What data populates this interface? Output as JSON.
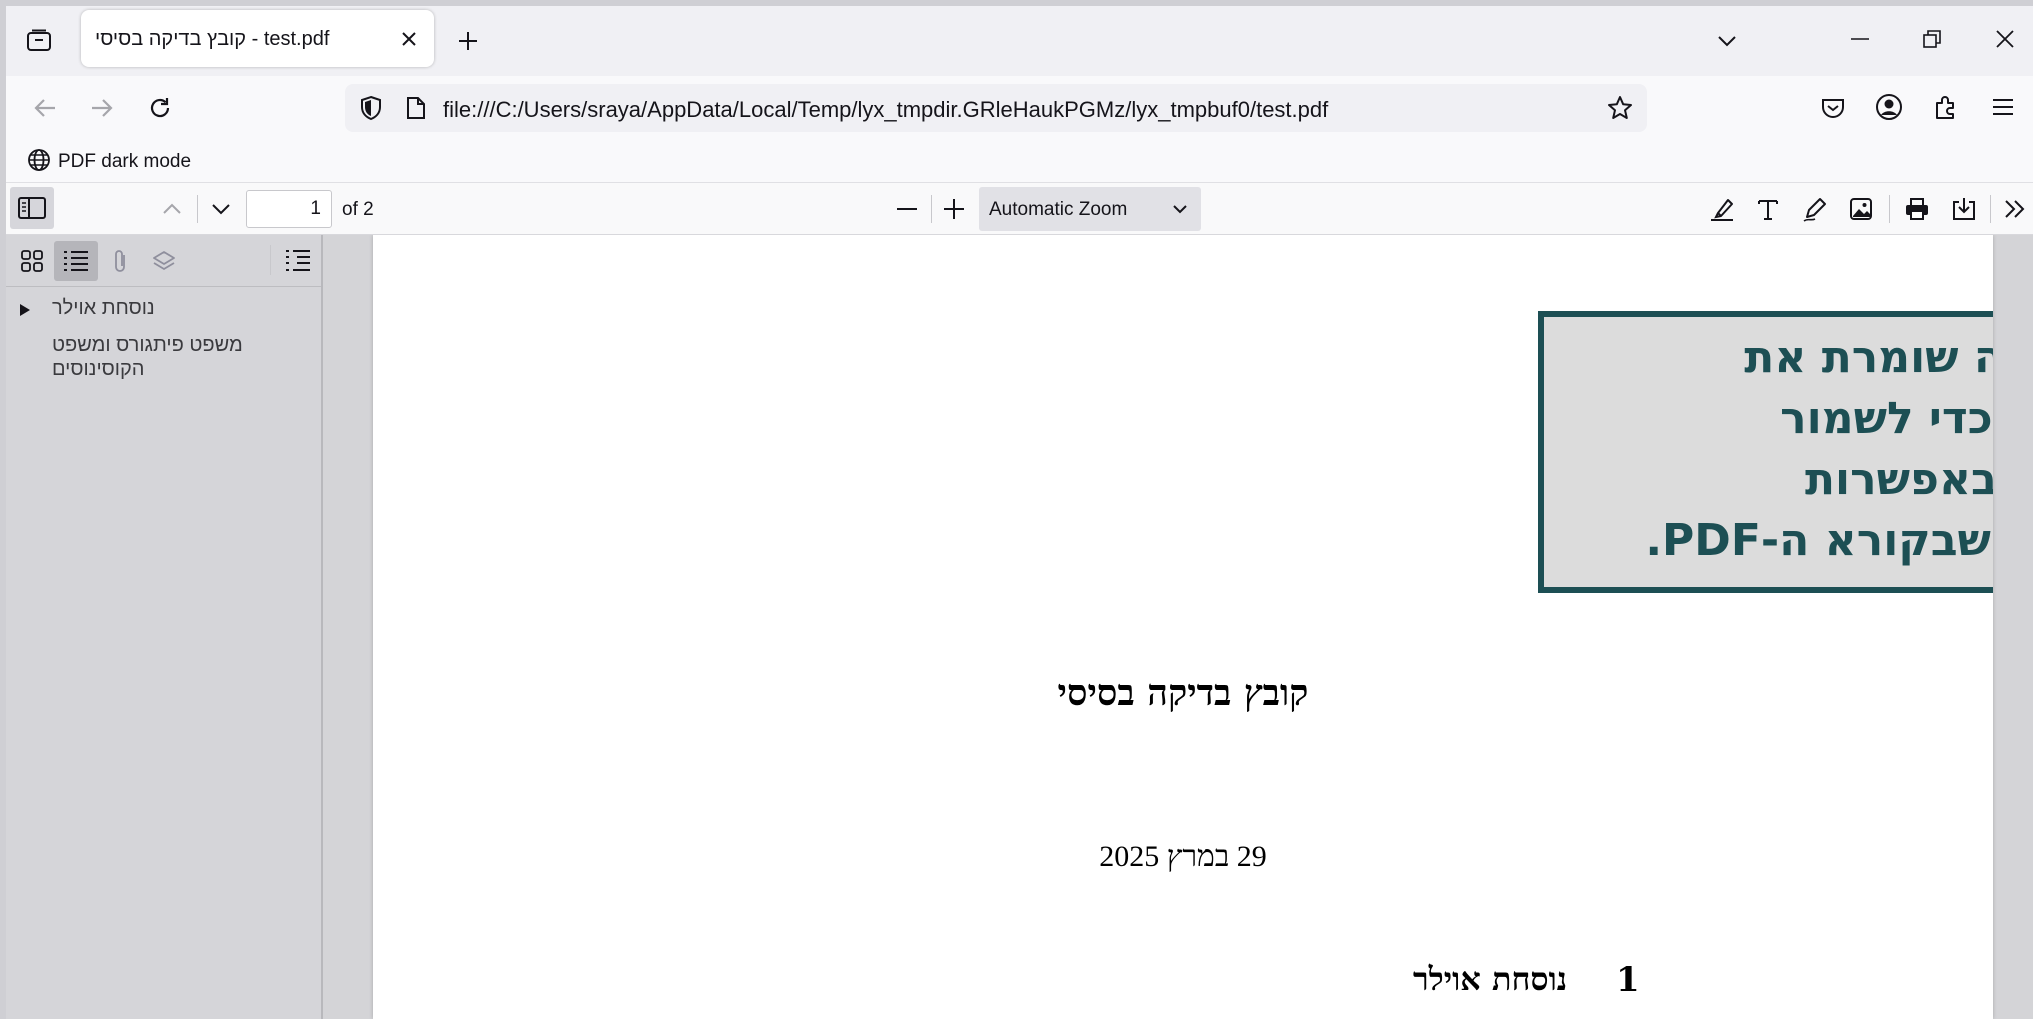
{
  "browser": {
    "tab": {
      "title": "קובץ בדיקה בסיסי - test.pdf"
    },
    "url": "file:///C:/Users/sraya/AppData/Local/Temp/lyx_tmpdir.GRleHaukPGMz/lyx_tmpbuf0/test.pdf",
    "bookmarks": [
      {
        "label": "PDF dark mode",
        "icon": "globe-icon"
      }
    ]
  },
  "pdf_toolbar": {
    "page_number": "1",
    "page_count": "of 2",
    "zoom": "Automatic Zoom"
  },
  "sidebar": {
    "outline": [
      {
        "label": "נוסחת אוילר",
        "expandable": true
      },
      {
        "label": "משפט פיתגורס ומשפט הקוסינוסים",
        "expandable": false
      }
    ]
  },
  "document": {
    "notice_lines": [
      "LyX אינה שומרת את",
      "ה-PDF, כדי לשמור",
      "השתמש באפשרות",
      "\"Save\" שבקורא ה-PDF."
    ],
    "title": "קובץ בדיקה בסיסי",
    "date": "29 במרץ 2025",
    "section_number": "1",
    "section_title": "נוסחת אוילר"
  },
  "colors": {
    "notice_border": "#1d4f54",
    "notice_bg": "#dcdcdc"
  }
}
